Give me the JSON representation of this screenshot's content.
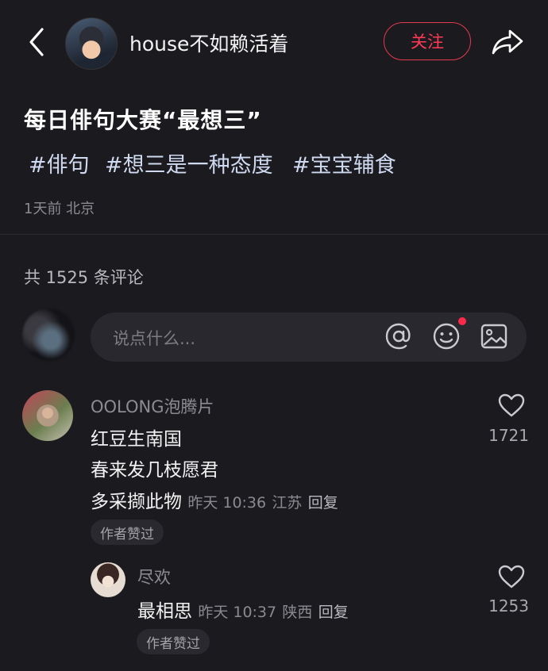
{
  "header": {
    "username": "house不如赖活着",
    "follow_label": "关注"
  },
  "post": {
    "title": "每日俳句大赛“最想三”",
    "tags": [
      "#俳句",
      "#想三是一种态度",
      "#宝宝辅食"
    ],
    "meta": "1天前 北京"
  },
  "comments_section": {
    "count_text": "共 1525 条评论",
    "input_placeholder": "说点什么..."
  },
  "comments": [
    {
      "username": "OOLONG泡腾片",
      "lines": [
        "红豆生南国",
        "春来发几枝愿君",
        "多采撷此物"
      ],
      "time": "昨天 10:36",
      "location": "江苏",
      "reply_label": "回复",
      "badge": "作者赞过",
      "likes": "1721"
    },
    {
      "username": "尽欢",
      "lines": [
        "最相思"
      ],
      "time": "昨天 10:37",
      "location": "陕西",
      "reply_label": "回复",
      "badge": "作者赞过",
      "likes": "1253"
    }
  ],
  "colors": {
    "background": "#1b1a1f",
    "accent": "#ff3b56",
    "tag": "#cfdaf0",
    "muted": "#8a8a90"
  },
  "icons": [
    "back-icon",
    "share-icon",
    "at-icon",
    "emoji-icon",
    "image-icon",
    "heart-icon"
  ]
}
